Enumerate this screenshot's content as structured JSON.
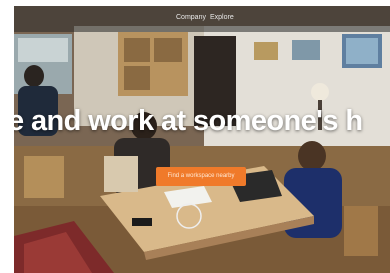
{
  "nav": {
    "items": [
      {
        "label": "Company"
      },
      {
        "label": "Explore"
      }
    ]
  },
  "hero": {
    "headline": "e and work at someone's h",
    "cta_label": "Find a workspace nearby"
  },
  "colors": {
    "accent": "#f07a2a",
    "topbar": "#2b2b2b"
  }
}
